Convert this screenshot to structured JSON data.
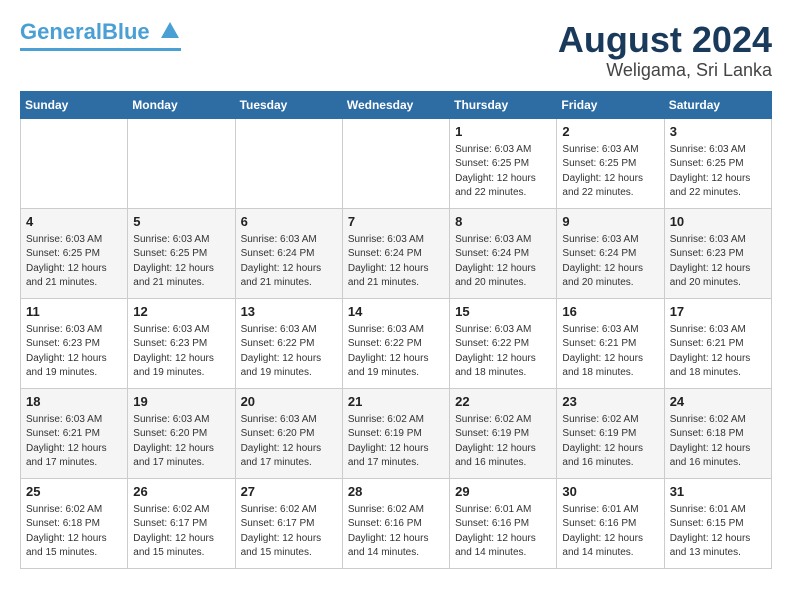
{
  "header": {
    "logo_line1": "General",
    "logo_line2": "Blue",
    "month": "August 2024",
    "location": "Weligama, Sri Lanka"
  },
  "weekdays": [
    "Sunday",
    "Monday",
    "Tuesday",
    "Wednesday",
    "Thursday",
    "Friday",
    "Saturday"
  ],
  "weeks": [
    [
      {
        "day": "",
        "detail": ""
      },
      {
        "day": "",
        "detail": ""
      },
      {
        "day": "",
        "detail": ""
      },
      {
        "day": "",
        "detail": ""
      },
      {
        "day": "1",
        "detail": "Sunrise: 6:03 AM\nSunset: 6:25 PM\nDaylight: 12 hours\nand 22 minutes."
      },
      {
        "day": "2",
        "detail": "Sunrise: 6:03 AM\nSunset: 6:25 PM\nDaylight: 12 hours\nand 22 minutes."
      },
      {
        "day": "3",
        "detail": "Sunrise: 6:03 AM\nSunset: 6:25 PM\nDaylight: 12 hours\nand 22 minutes."
      }
    ],
    [
      {
        "day": "4",
        "detail": "Sunrise: 6:03 AM\nSunset: 6:25 PM\nDaylight: 12 hours\nand 21 minutes."
      },
      {
        "day": "5",
        "detail": "Sunrise: 6:03 AM\nSunset: 6:25 PM\nDaylight: 12 hours\nand 21 minutes."
      },
      {
        "day": "6",
        "detail": "Sunrise: 6:03 AM\nSunset: 6:24 PM\nDaylight: 12 hours\nand 21 minutes."
      },
      {
        "day": "7",
        "detail": "Sunrise: 6:03 AM\nSunset: 6:24 PM\nDaylight: 12 hours\nand 21 minutes."
      },
      {
        "day": "8",
        "detail": "Sunrise: 6:03 AM\nSunset: 6:24 PM\nDaylight: 12 hours\nand 20 minutes."
      },
      {
        "day": "9",
        "detail": "Sunrise: 6:03 AM\nSunset: 6:24 PM\nDaylight: 12 hours\nand 20 minutes."
      },
      {
        "day": "10",
        "detail": "Sunrise: 6:03 AM\nSunset: 6:23 PM\nDaylight: 12 hours\nand 20 minutes."
      }
    ],
    [
      {
        "day": "11",
        "detail": "Sunrise: 6:03 AM\nSunset: 6:23 PM\nDaylight: 12 hours\nand 19 minutes."
      },
      {
        "day": "12",
        "detail": "Sunrise: 6:03 AM\nSunset: 6:23 PM\nDaylight: 12 hours\nand 19 minutes."
      },
      {
        "day": "13",
        "detail": "Sunrise: 6:03 AM\nSunset: 6:22 PM\nDaylight: 12 hours\nand 19 minutes."
      },
      {
        "day": "14",
        "detail": "Sunrise: 6:03 AM\nSunset: 6:22 PM\nDaylight: 12 hours\nand 19 minutes."
      },
      {
        "day": "15",
        "detail": "Sunrise: 6:03 AM\nSunset: 6:22 PM\nDaylight: 12 hours\nand 18 minutes."
      },
      {
        "day": "16",
        "detail": "Sunrise: 6:03 AM\nSunset: 6:21 PM\nDaylight: 12 hours\nand 18 minutes."
      },
      {
        "day": "17",
        "detail": "Sunrise: 6:03 AM\nSunset: 6:21 PM\nDaylight: 12 hours\nand 18 minutes."
      }
    ],
    [
      {
        "day": "18",
        "detail": "Sunrise: 6:03 AM\nSunset: 6:21 PM\nDaylight: 12 hours\nand 17 minutes."
      },
      {
        "day": "19",
        "detail": "Sunrise: 6:03 AM\nSunset: 6:20 PM\nDaylight: 12 hours\nand 17 minutes."
      },
      {
        "day": "20",
        "detail": "Sunrise: 6:03 AM\nSunset: 6:20 PM\nDaylight: 12 hours\nand 17 minutes."
      },
      {
        "day": "21",
        "detail": "Sunrise: 6:02 AM\nSunset: 6:19 PM\nDaylight: 12 hours\nand 17 minutes."
      },
      {
        "day": "22",
        "detail": "Sunrise: 6:02 AM\nSunset: 6:19 PM\nDaylight: 12 hours\nand 16 minutes."
      },
      {
        "day": "23",
        "detail": "Sunrise: 6:02 AM\nSunset: 6:19 PM\nDaylight: 12 hours\nand 16 minutes."
      },
      {
        "day": "24",
        "detail": "Sunrise: 6:02 AM\nSunset: 6:18 PM\nDaylight: 12 hours\nand 16 minutes."
      }
    ],
    [
      {
        "day": "25",
        "detail": "Sunrise: 6:02 AM\nSunset: 6:18 PM\nDaylight: 12 hours\nand 15 minutes."
      },
      {
        "day": "26",
        "detail": "Sunrise: 6:02 AM\nSunset: 6:17 PM\nDaylight: 12 hours\nand 15 minutes."
      },
      {
        "day": "27",
        "detail": "Sunrise: 6:02 AM\nSunset: 6:17 PM\nDaylight: 12 hours\nand 15 minutes."
      },
      {
        "day": "28",
        "detail": "Sunrise: 6:02 AM\nSunset: 6:16 PM\nDaylight: 12 hours\nand 14 minutes."
      },
      {
        "day": "29",
        "detail": "Sunrise: 6:01 AM\nSunset: 6:16 PM\nDaylight: 12 hours\nand 14 minutes."
      },
      {
        "day": "30",
        "detail": "Sunrise: 6:01 AM\nSunset: 6:16 PM\nDaylight: 12 hours\nand 14 minutes."
      },
      {
        "day": "31",
        "detail": "Sunrise: 6:01 AM\nSunset: 6:15 PM\nDaylight: 12 hours\nand 13 minutes."
      }
    ]
  ]
}
